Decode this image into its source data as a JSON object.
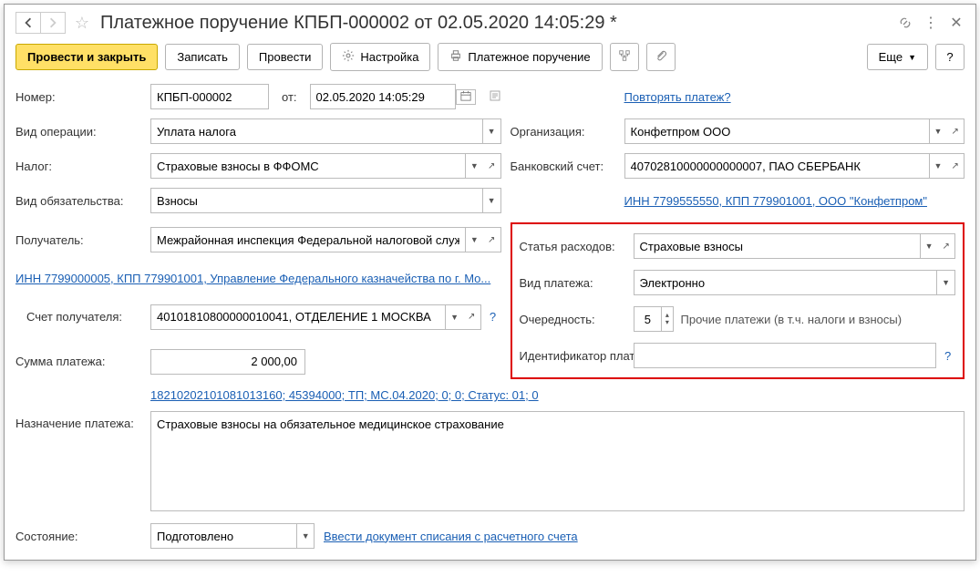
{
  "header": {
    "title": "Платежное поручение КПБП-000002 от 02.05.2020 14:05:29 *"
  },
  "toolbar": {
    "post_close": "Провести и закрыть",
    "save": "Записать",
    "post": "Провести",
    "settings": "Настройка",
    "print": "Платежное поручение",
    "more": "Еще",
    "help": "?"
  },
  "fields": {
    "number_label": "Номер:",
    "number": "КПБП-000002",
    "from_label": "от:",
    "date": "02.05.2020 14:05:29",
    "repeat_link": "Повторять платеж?",
    "op_type_label": "Вид операции:",
    "op_type": "Уплата налога",
    "org_label": "Организация:",
    "org": "Конфетпром ООО",
    "tax_label": "Налог:",
    "tax": "Страховые взносы в ФФОМС",
    "bank_acc_label": "Банковский счет:",
    "bank_acc": "40702810000000000007, ПАО СБЕРБАНК",
    "liab_type_label": "Вид обязательства:",
    "liab_type": "Взносы",
    "org_link": "ИНН 7799555550, КПП 779901001, ООО \"Конфетпром\"",
    "payee_label": "Получатель:",
    "payee": "Межрайонная инспекция Федеральной налоговой службы",
    "payee_link": "ИНН 7799000005, КПП 779901001, Управление Федерального казначейства по г. Мо...",
    "payee_acc_label": "Счет получателя:",
    "payee_acc": "40101810800000010041, ОТДЕЛЕНИЕ 1 МОСКВА",
    "sum_label": "Сумма платежа:",
    "sum": "2 000,00",
    "kbk_link": "18210202101081013160; 45394000; ТП; МС.04.2020; 0; 0; Статус: 01; 0",
    "purpose_label": "Назначение платежа:",
    "purpose": "Страховые взносы на обязательное медицинское страхование",
    "status_label": "Состояние:",
    "status": "Подготовлено",
    "status_link": "Ввести документ списания с расчетного счета"
  },
  "hl": {
    "expense_label": "Статья расходов:",
    "expense": "Страховые взносы",
    "pay_type_label": "Вид платежа:",
    "pay_type": "Электронно",
    "order_label": "Очередность:",
    "order": "5",
    "order_hint": "Прочие платежи (в т.ч. налоги и взносы)",
    "ident_label": "Идентификатор платежа:",
    "ident": ""
  }
}
